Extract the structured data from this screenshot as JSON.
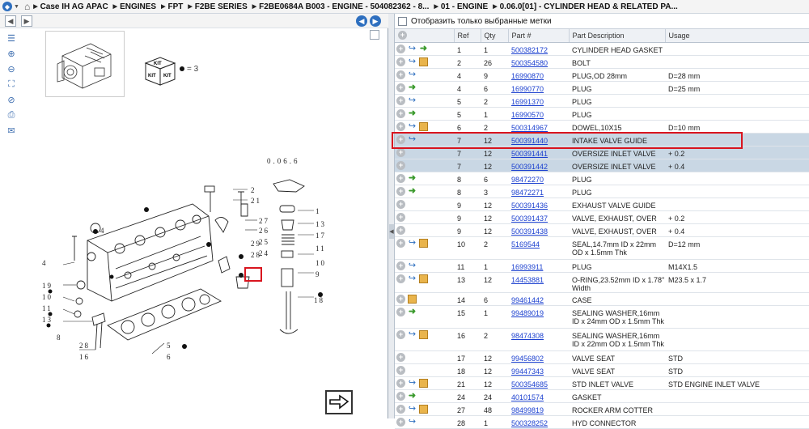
{
  "breadcrumb": [
    "Case IH AG APAC",
    "ENGINES",
    "FPT",
    "F2BE SERIES",
    "F2BE0684A B003 - ENGINE - 504082362 - 8...",
    "01 - ENGINE",
    "0.06.0[01] - CYLINDER HEAD & RELATED PA..."
  ],
  "filter_label": "Отобразить только выбранные метки",
  "kit_label": "KIT",
  "kit_ref": "= 3",
  "columns": [
    "",
    "Ref",
    "Qty",
    "Part #",
    "Part Description",
    "Usage"
  ],
  "rows": [
    {
      "icons": [
        "plus",
        "link",
        "arrow"
      ],
      "ref": "1",
      "qty": "1",
      "part": "500382172",
      "desc": "CYLINDER HEAD GASKET",
      "usage": ""
    },
    {
      "icons": [
        "plus",
        "link",
        "box"
      ],
      "ref": "2",
      "qty": "26",
      "part": "500354580",
      "desc": "BOLT",
      "usage": ""
    },
    {
      "icons": [
        "plus",
        "link"
      ],
      "ref": "4",
      "qty": "9",
      "part": "16990870",
      "desc": "PLUG,OD 28mm",
      "usage": "D=28 mm"
    },
    {
      "icons": [
        "plus",
        "arrow"
      ],
      "ref": "4",
      "qty": "6",
      "part": "16990770",
      "desc": "PLUG",
      "usage": "D=25 mm"
    },
    {
      "icons": [
        "plus",
        "link"
      ],
      "ref": "5",
      "qty": "2",
      "part": "16991370",
      "desc": "PLUG",
      "usage": ""
    },
    {
      "icons": [
        "plus",
        "arrow"
      ],
      "ref": "5",
      "qty": "1",
      "part": "16990570",
      "desc": "PLUG",
      "usage": ""
    },
    {
      "icons": [
        "plus",
        "link",
        "box"
      ],
      "ref": "6",
      "qty": "2",
      "part": "500314967",
      "desc": "DOWEL,10X15",
      "usage": "D=10 mm"
    },
    {
      "icons": [
        "plus",
        "link"
      ],
      "ref": "7",
      "qty": "12",
      "part": "500391440",
      "desc": "INTAKE VALVE GUIDE",
      "usage": "",
      "selected": true
    },
    {
      "icons": [
        "plus"
      ],
      "ref": "7",
      "qty": "12",
      "part": "500391441",
      "desc": "OVERSIZE INLET VALVE",
      "usage": "+ 0.2",
      "selected": true
    },
    {
      "icons": [
        "plus"
      ],
      "ref": "7",
      "qty": "12",
      "part": "500391442",
      "desc": "OVERSIZE INLET VALVE",
      "usage": "+ 0.4",
      "selected": true
    },
    {
      "icons": [
        "plus",
        "arrow"
      ],
      "ref": "8",
      "qty": "6",
      "part": "98472270",
      "desc": "PLUG",
      "usage": ""
    },
    {
      "icons": [
        "plus",
        "arrow"
      ],
      "ref": "8",
      "qty": "3",
      "part": "98472271",
      "desc": "PLUG",
      "usage": ""
    },
    {
      "icons": [
        "plus"
      ],
      "ref": "9",
      "qty": "12",
      "part": "500391436",
      "desc": "EXHAUST VALVE GUIDE",
      "usage": ""
    },
    {
      "icons": [
        "plus"
      ],
      "ref": "9",
      "qty": "12",
      "part": "500391437",
      "desc": "VALVE, EXHAUST, OVER",
      "usage": "+ 0.2"
    },
    {
      "icons": [
        "plus"
      ],
      "ref": "9",
      "qty": "12",
      "part": "500391438",
      "desc": "VALVE, EXHAUST, OVER",
      "usage": "+ 0.4"
    },
    {
      "icons": [
        "plus",
        "link",
        "box"
      ],
      "ref": "10",
      "qty": "2",
      "part": "5169544",
      "desc": "SEAL,14.7mm ID x 22mm OD x 1.5mm Thk",
      "usage": "D=12 mm",
      "tall": true
    },
    {
      "icons": [
        "plus",
        "link"
      ],
      "ref": "11",
      "qty": "1",
      "part": "16993911",
      "desc": "PLUG",
      "usage": "M14X1.5"
    },
    {
      "icons": [
        "plus",
        "link",
        "box"
      ],
      "ref": "13",
      "qty": "12",
      "part": "14453881",
      "desc": "O-RING,23.52mm ID x 1.78\" Width",
      "usage": "M23.5 x 1.7"
    },
    {
      "icons": [
        "plus",
        "box"
      ],
      "ref": "14",
      "qty": "6",
      "part": "99461442",
      "desc": "CASE",
      "usage": ""
    },
    {
      "icons": [
        "plus",
        "arrow"
      ],
      "ref": "15",
      "qty": "1",
      "part": "99489019",
      "desc": "SEALING WASHER,16mm ID x 24mm OD x 1.5mm Thk",
      "usage": "",
      "tall": true
    },
    {
      "icons": [
        "plus",
        "link",
        "box"
      ],
      "ref": "16",
      "qty": "2",
      "part": "98474308",
      "desc": "SEALING WASHER,16mm ID x 22mm OD x 1.5mm Thk",
      "usage": "",
      "tall": true
    },
    {
      "icons": [
        "plus"
      ],
      "ref": "17",
      "qty": "12",
      "part": "99456802",
      "desc": "VALVE SEAT",
      "usage": "STD"
    },
    {
      "icons": [
        "plus"
      ],
      "ref": "18",
      "qty": "12",
      "part": "99447343",
      "desc": "VALVE SEAT",
      "usage": "STD"
    },
    {
      "icons": [
        "plus",
        "link",
        "box"
      ],
      "ref": "21",
      "qty": "12",
      "part": "500354685",
      "desc": "STD INLET VALVE",
      "usage": "STD ENGINE INLET VALVE"
    },
    {
      "icons": [
        "plus",
        "arrow"
      ],
      "ref": "24",
      "qty": "24",
      "part": "40101574",
      "desc": "GASKET",
      "usage": ""
    },
    {
      "icons": [
        "plus",
        "link",
        "box"
      ],
      "ref": "27",
      "qty": "48",
      "part": "98499819",
      "desc": "ROCKER ARM COTTER",
      "usage": ""
    },
    {
      "icons": [
        "plus",
        "link"
      ],
      "ref": "28",
      "qty": "1",
      "part": "500328252",
      "desc": "HYD CONNECTOR",
      "usage": ""
    }
  ],
  "callouts": {
    "top": "0.06.6",
    "n1": "1",
    "n2": "2",
    "n3": "3",
    "n4": "4",
    "n5": "5",
    "n6": "6",
    "n7": "7",
    "n8": "8",
    "n9": "9",
    "n10": "10",
    "n11": "11",
    "n13": "13",
    "n14": "14",
    "n15": "15",
    "n16": "16",
    "n17": "17",
    "n18": "18",
    "n19": "19",
    "n21": "21",
    "n24": "24",
    "n25": "25",
    "n26": "26",
    "n27": "27",
    "n28": "28",
    "n29": "29"
  }
}
